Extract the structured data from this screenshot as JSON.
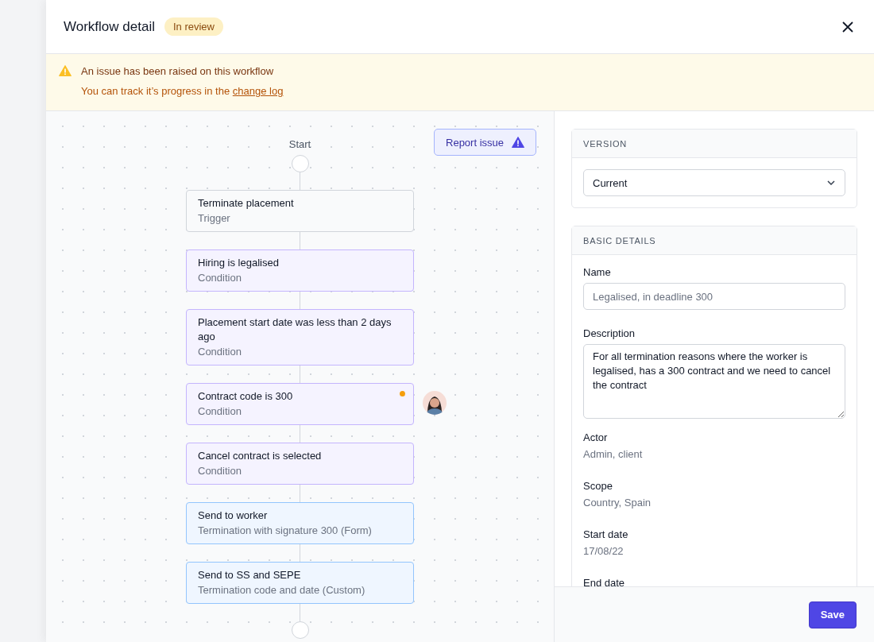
{
  "header": {
    "title": "Workflow detail",
    "status": "In review"
  },
  "alert": {
    "title": "An issue has been raised on this workflow",
    "text": "You can track it’s progress in the",
    "link": "change log"
  },
  "report_button": "Report issue",
  "flow": {
    "start": "Start",
    "nodes": [
      {
        "kind": "trigger",
        "title": "Terminate placement",
        "subtitle": "Trigger",
        "flagged": false,
        "assignee": false
      },
      {
        "kind": "condition",
        "title": "Hiring is legalised",
        "subtitle": "Condition",
        "flagged": false,
        "assignee": false
      },
      {
        "kind": "condition",
        "title": "Placement start date was less than 2 days ago",
        "subtitle": "Condition",
        "flagged": false,
        "assignee": false
      },
      {
        "kind": "condition",
        "title": "Contract code is 300",
        "subtitle": "Condition",
        "flagged": true,
        "assignee": true
      },
      {
        "kind": "condition",
        "title": "Cancel contract is selected",
        "subtitle": "Condition",
        "flagged": false,
        "assignee": false
      },
      {
        "kind": "action",
        "title": "Send to worker",
        "subtitle": "Termination with signature 300 (Form)",
        "flagged": false,
        "assignee": false
      },
      {
        "kind": "action",
        "title": "Send to SS and SEPE",
        "subtitle": "Termination code and date (Custom)",
        "flagged": false,
        "assignee": false
      }
    ]
  },
  "version": {
    "heading": "VERSION",
    "value": "Current"
  },
  "details": {
    "heading": "BASIC DETAILS",
    "name_label": "Name",
    "name_placeholder": "Legalised, in deadline 300",
    "description_label": "Description",
    "description": "For all termination reasons where the worker is legalised, has a 300 contract and we need to cancel the contract",
    "fields": [
      {
        "label": "Actor",
        "value": "Admin, client"
      },
      {
        "label": "Scope",
        "value": "Country, Spain"
      },
      {
        "label": "Start date",
        "value": "17/08/22"
      }
    ],
    "cut_label": "End date"
  },
  "save_button": "Save"
}
